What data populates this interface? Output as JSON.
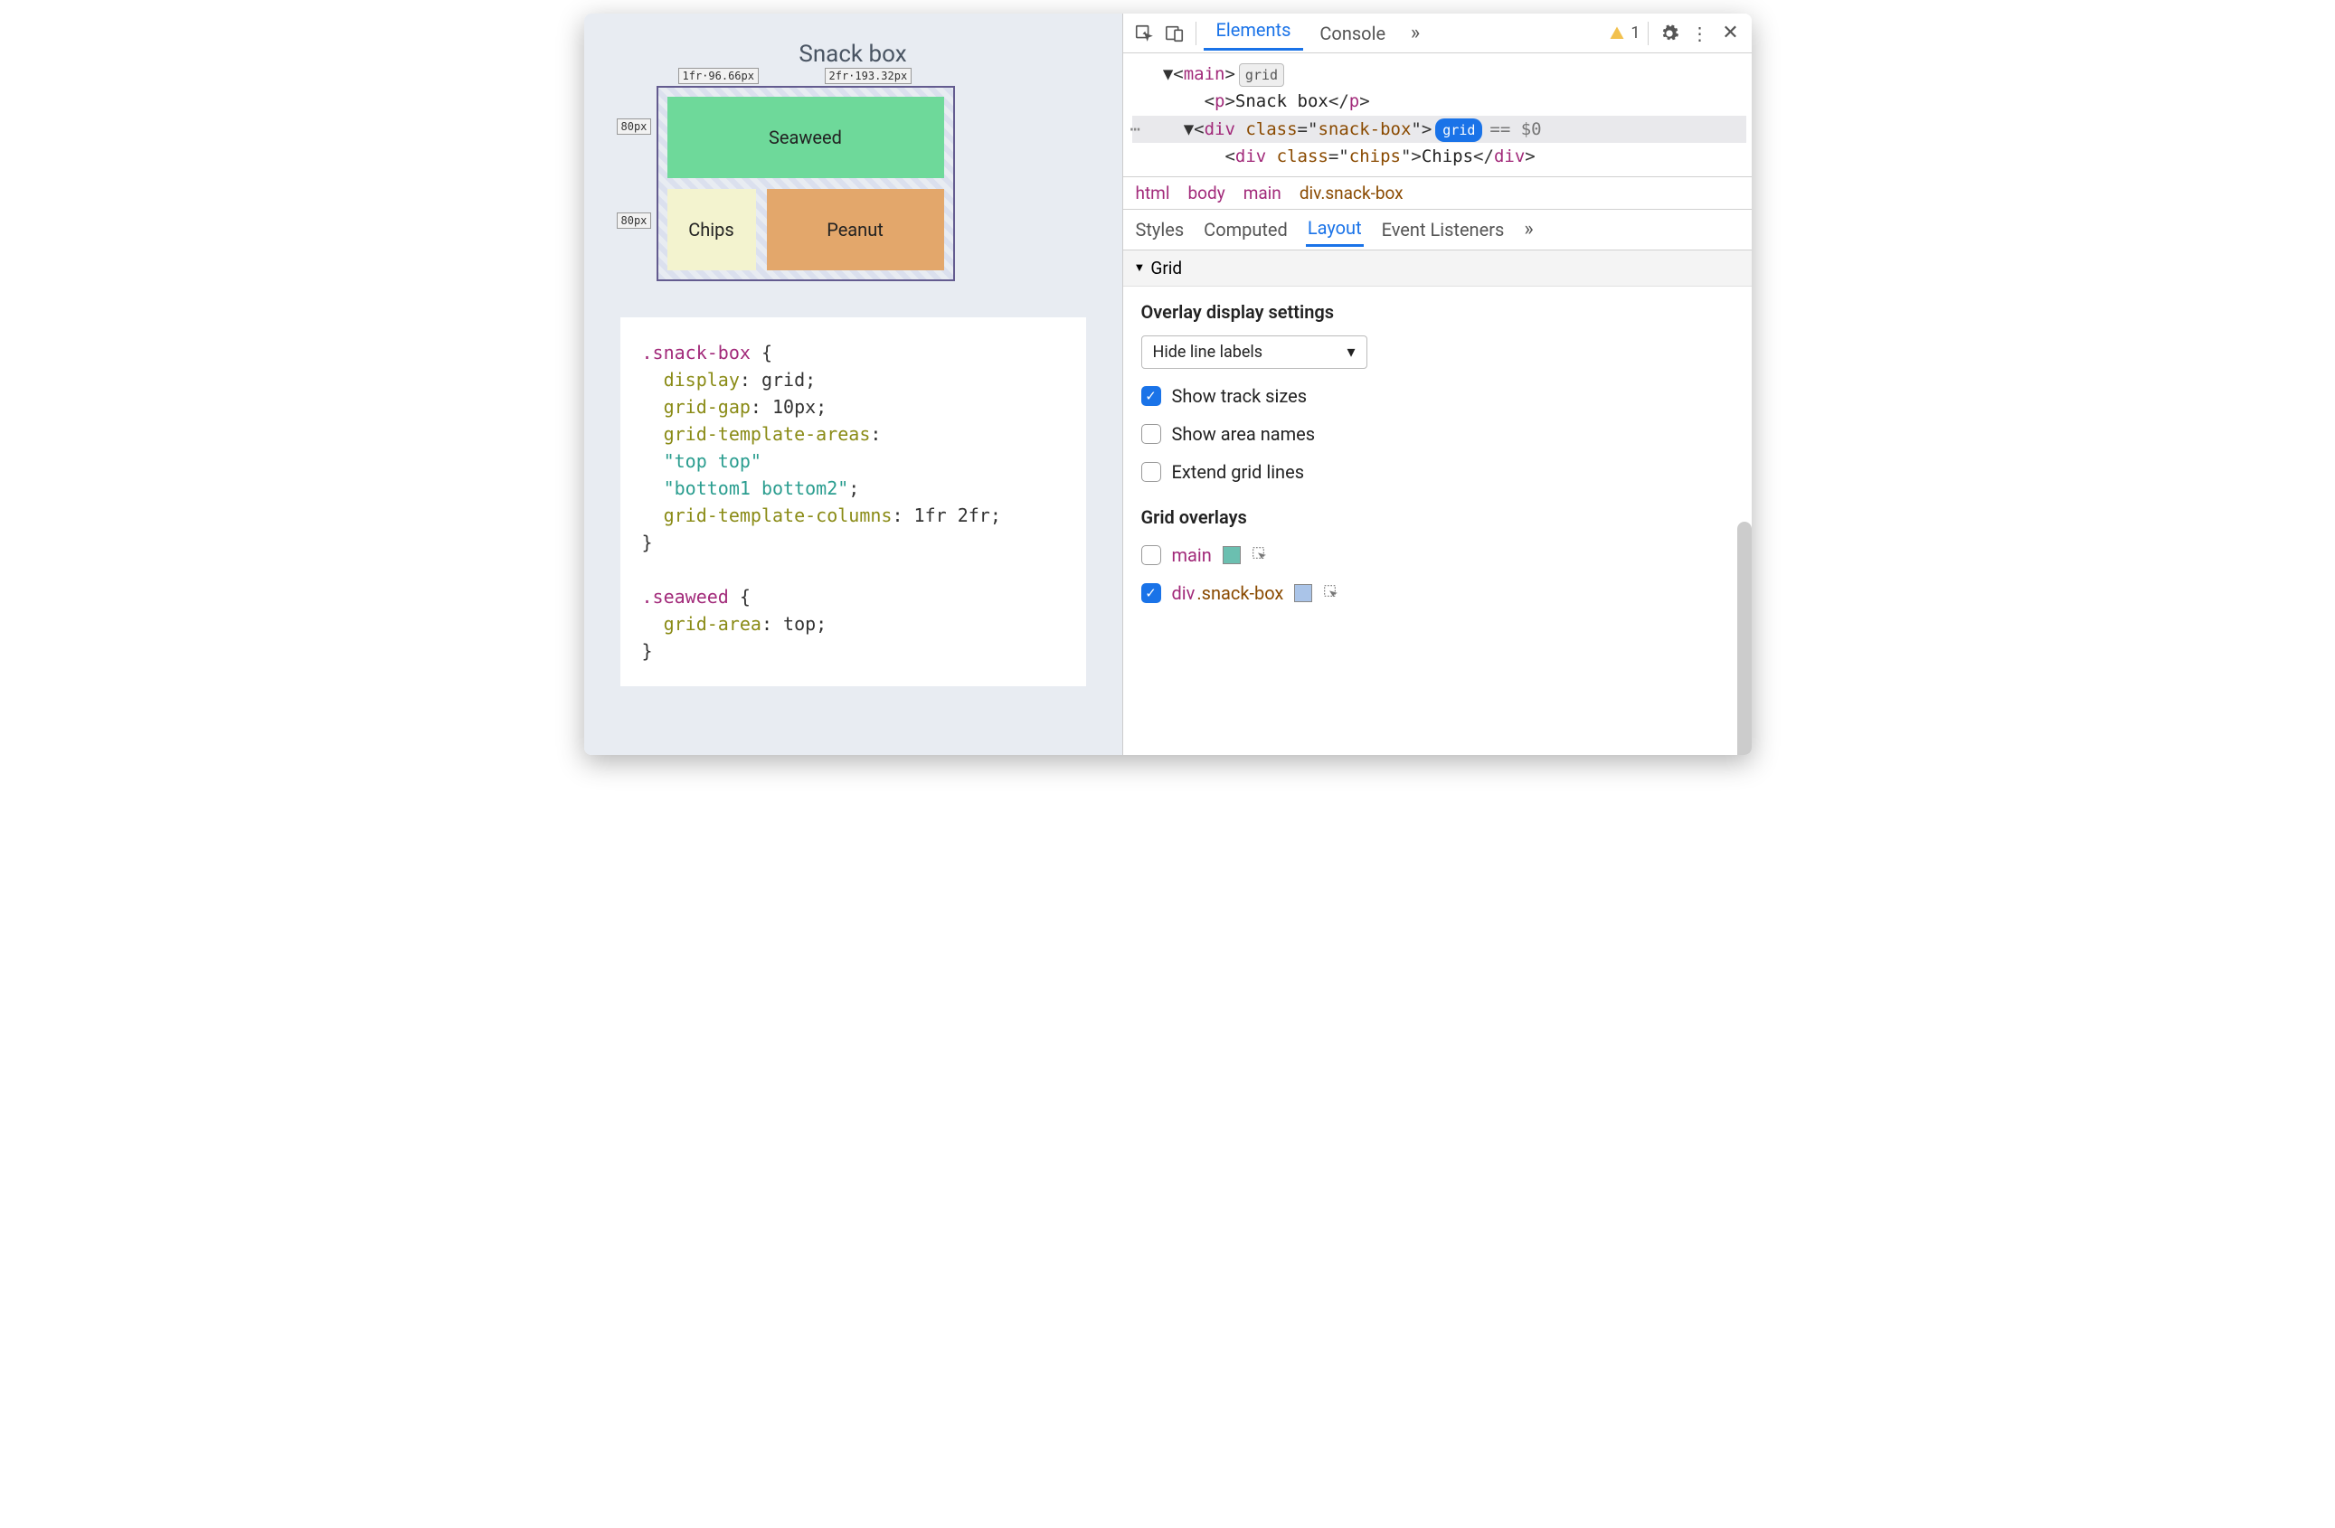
{
  "page": {
    "title": "Snack box",
    "grid": {
      "col_labels": [
        "1fr·96.66px",
        "2fr·193.32px"
      ],
      "row_labels": [
        "80px",
        "80px"
      ],
      "cells": {
        "seaweed": "Seaweed",
        "chips": "Chips",
        "peanut": "Peanut"
      }
    },
    "css_code": ".snack-box {\n  display: grid;\n  grid-gap: 10px;\n  grid-template-areas:\n  \"top top\"\n  \"bottom1 bottom2\";\n  grid-template-columns: 1fr 2fr;\n}\n\n.seaweed {\n  grid-area: top;\n}"
  },
  "devtools": {
    "toolbar": {
      "tabs": [
        "Elements",
        "Console"
      ],
      "active_tab": "Elements",
      "warning_count": "1"
    },
    "dom": {
      "lines": [
        {
          "indent": 1,
          "open": "main",
          "badge": "grid"
        },
        {
          "indent": 2,
          "tag": "p",
          "text": "Snack box"
        },
        {
          "indent": 2,
          "open": "div",
          "class": "snack-box",
          "badge_blue": "grid",
          "dollar": "== $0",
          "selected": true
        },
        {
          "indent": 3,
          "tag": "div",
          "class": "chips",
          "text": "Chips"
        }
      ]
    },
    "breadcrumb": [
      "html",
      "body",
      "main",
      "div.snack-box"
    ],
    "sub_tabs": [
      "Styles",
      "Computed",
      "Layout",
      "Event Listeners"
    ],
    "active_sub_tab": "Layout",
    "grid_section": {
      "title": "Grid",
      "overlay_heading": "Overlay display settings",
      "dropdown_value": "Hide line labels",
      "checkboxes": [
        {
          "label": "Show track sizes",
          "checked": true
        },
        {
          "label": "Show area names",
          "checked": false
        },
        {
          "label": "Extend grid lines",
          "checked": false
        }
      ],
      "overlays_heading": "Grid overlays",
      "overlays": [
        {
          "label": "main",
          "checked": false,
          "swatch": "main"
        },
        {
          "label": "div.snack-box",
          "checked": true,
          "swatch": "snack"
        }
      ]
    }
  }
}
